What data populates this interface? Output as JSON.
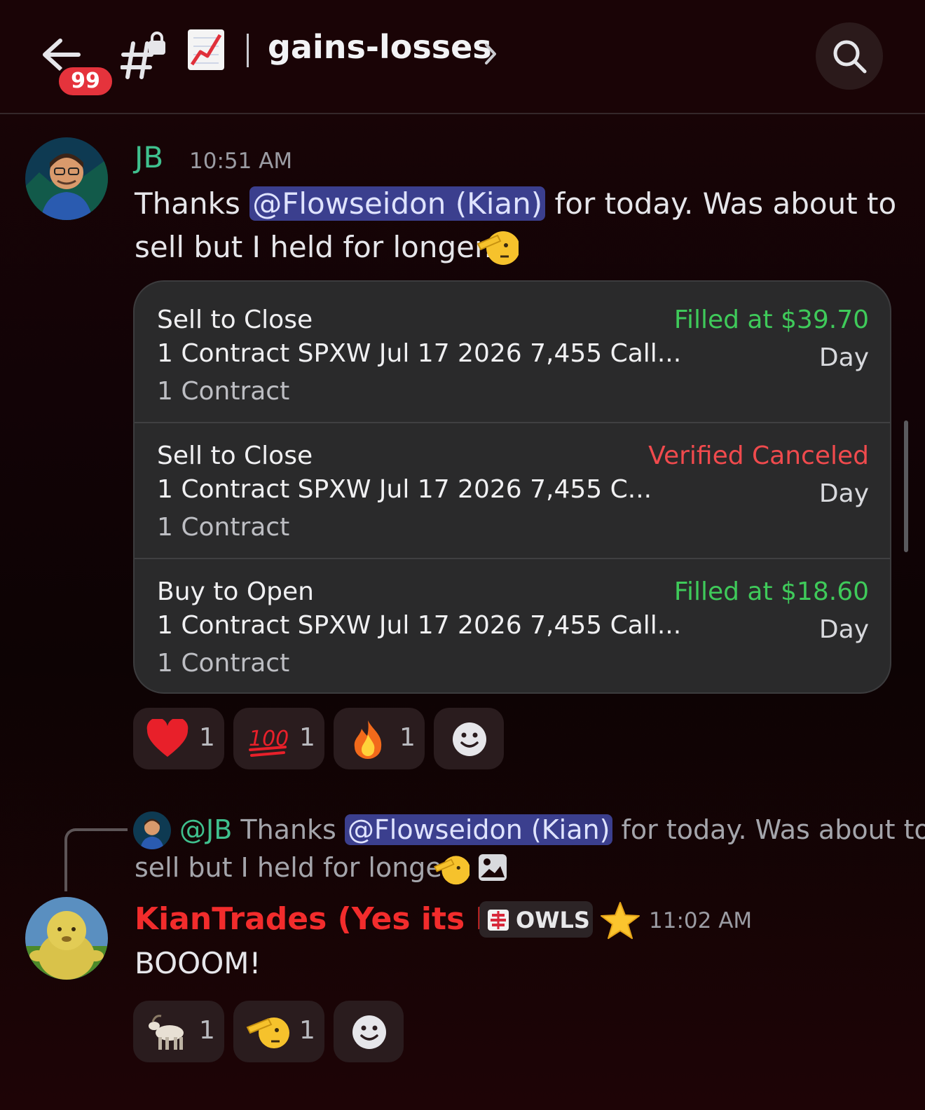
{
  "header": {
    "unread_count": "99",
    "channel_name": "gains-losses"
  },
  "messages": [
    {
      "author": "JB",
      "timestamp": "10:51 AM",
      "text_before": "Thanks ",
      "mention": "@Flowseidon (Kian)",
      "text_after_line1": " for today. Was about to",
      "text_line2": "sell but I held for longer."
    }
  ],
  "orders": [
    {
      "action": "Sell to Close",
      "description": "1 Contract SPXW Jul 17 2026 7,455 Call...",
      "quantity": "1 Contract",
      "status": "Filled at $39.70",
      "time_in_force": "Day"
    },
    {
      "action": "Sell to Close",
      "description": "1 Contract SPXW Jul 17 2026 7,455 C...",
      "quantity": "1 Contract",
      "status": "Verified Canceled",
      "time_in_force": "Day"
    },
    {
      "action": "Buy to Open",
      "description": "1 Contract SPXW Jul 17 2026 7,455 Call...",
      "quantity": "1 Contract",
      "status": "Filled at $18.60",
      "time_in_force": "Day"
    }
  ],
  "reactions_1": [
    {
      "icon": "heart-emoji",
      "count": "1"
    },
    {
      "icon": "hundred-emoji",
      "count": "1"
    },
    {
      "icon": "fire-emoji",
      "count": "1"
    }
  ],
  "reply": {
    "author": "@JB",
    "text_before": " Thanks ",
    "mention": "@Flowseidon (Kian)",
    "text_after": " for today. Was about to",
    "text_line2": "sell but I held for longer."
  },
  "message2": {
    "author": "KianTrades (Yes its Me)",
    "tag": "OWLS",
    "timestamp": "11:02 AM",
    "text": "BOOOM!"
  },
  "reactions_2": [
    {
      "icon": "goat-emoji",
      "count": "1"
    },
    {
      "icon": "saluting-face-emoji",
      "count": "1"
    }
  ],
  "colors": {
    "background": "#120306",
    "accent_green": "#3fca5a",
    "accent_red": "#f04a4d",
    "author_green": "#3fc08e",
    "author_red": "#f22c2c",
    "mention_bg": "#3b3f8e"
  }
}
